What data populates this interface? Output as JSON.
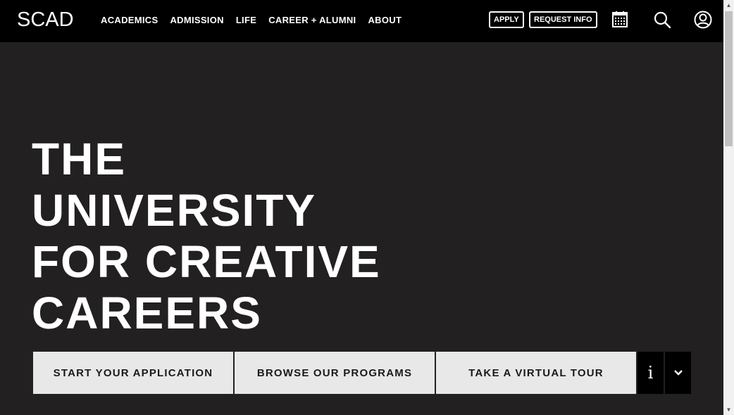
{
  "header": {
    "logo": "SCAD",
    "nav": [
      "ACADEMICS",
      "ADMISSION",
      "LIFE",
      "CAREER + ALUMNI",
      "ABOUT"
    ],
    "apply_label": "APPLY",
    "request_info_label": "REQUEST INFO",
    "icons": [
      "calendar-icon",
      "search-icon",
      "user-icon"
    ]
  },
  "hero": {
    "title_lines": [
      "THE",
      "UNIVERSITY",
      "FOR CREATIVE",
      "CAREERS"
    ]
  },
  "cta": {
    "buttons": [
      "START YOUR APPLICATION",
      "BROWSE OUR PROGRAMS",
      "TAKE A VIRTUAL TOUR"
    ],
    "info_label": "i"
  },
  "colors": {
    "header_bg": "#000000",
    "page_bg": "#222021",
    "cta_bg": "#e8e8e8"
  }
}
